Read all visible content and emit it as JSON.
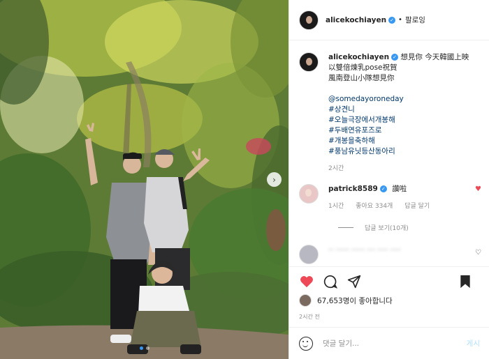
{
  "post": {
    "username": "alicekochiayen",
    "separator": "•",
    "follow_label": "팔로잉",
    "caption": {
      "lines": [
        "想見你 今天韓國上映",
        "以雙倍煉乳pose祝賀",
        "風南登山小隊想見你"
      ],
      "mention": "@somedayoroneday",
      "hashtags": [
        "#상견니",
        "#오늘극장에서개봉해",
        "#두배연유포즈로",
        "#개봉을축하해",
        "#풍남유닛등산동아리"
      ],
      "time": "2시간"
    },
    "comment": {
      "username": "patrick8589",
      "text": "讚啦",
      "time": "1시간",
      "likes": "좋아요 334개",
      "reply_label": "답글 달기",
      "view_replies": "답글 보기(10개)"
    },
    "blurred_comment": "-- ----- ----- --- ---- ----",
    "likes_count": "67,653명이 좋아합니다",
    "posted_time": "2시간 전",
    "comment_placeholder": "댓글 달기...",
    "post_button": "게시"
  },
  "colors": {
    "heart": "#ed4956",
    "verified": "#3897f0",
    "link": "#00376b",
    "muted": "#8e8e8e"
  }
}
